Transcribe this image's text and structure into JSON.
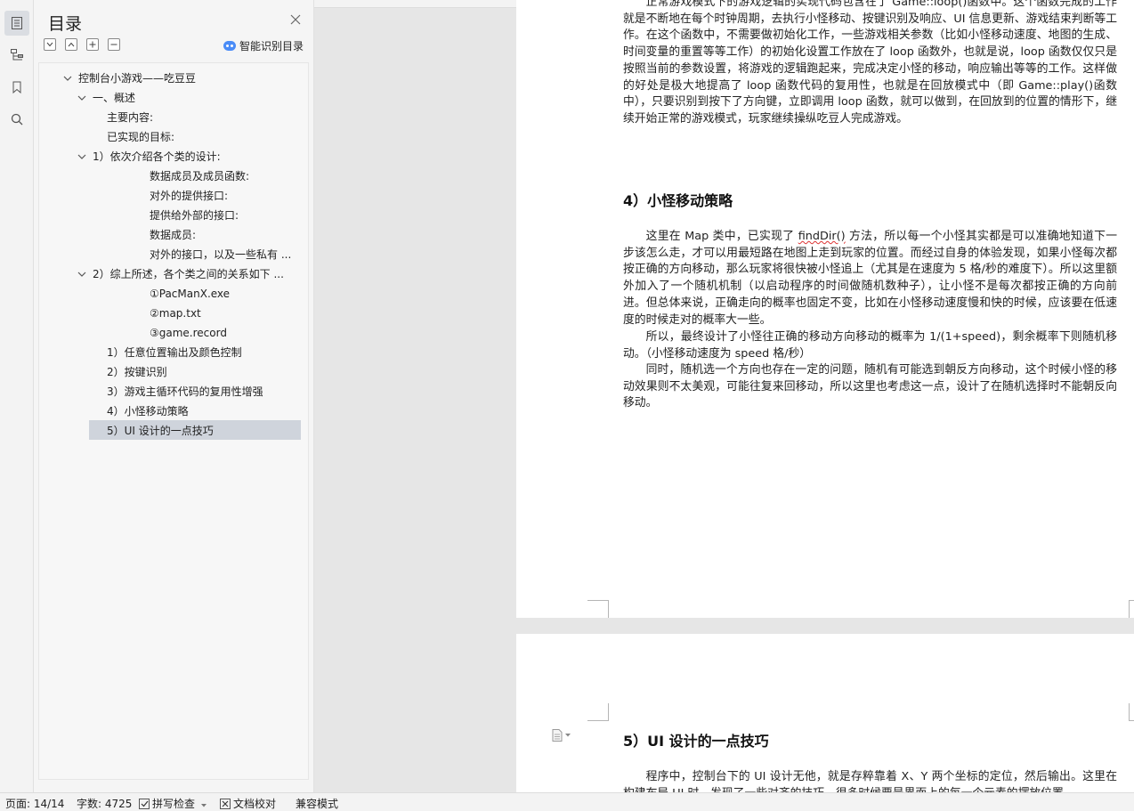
{
  "toc": {
    "title": "目录",
    "smart_label": "智能识别目录",
    "items": [
      {
        "label": "控制台小游戏——吃豆豆",
        "level": 0,
        "expanded": true
      },
      {
        "label": "一、概述",
        "level": 1,
        "expanded": true
      },
      {
        "label": "主要内容:",
        "level": 2
      },
      {
        "label": "已实现的目标:",
        "level": 2
      },
      {
        "label": "1）依次介绍各个类的设计:",
        "level": 1,
        "expanded": true
      },
      {
        "label": "数据成员及成员函数:",
        "level": 3
      },
      {
        "label": "对外的提供接口:",
        "level": 3
      },
      {
        "label": "提供给外部的接口:",
        "level": 3
      },
      {
        "label": "数据成员:",
        "level": 3
      },
      {
        "label": "对外的接口，以及一些私有 ...",
        "level": 3
      },
      {
        "label": "2）综上所述，各个类之间的关系如下 ...",
        "level": 1,
        "expanded": true
      },
      {
        "label": "①PacManX.exe",
        "level": 3
      },
      {
        "label": "②map.txt",
        "level": 3
      },
      {
        "label": "③game.record",
        "level": 3
      },
      {
        "label": "1）任意位置输出及颜色控制",
        "level": 2
      },
      {
        "label": "2）按键识别",
        "level": 2
      },
      {
        "label": "3）游戏主循环代码的复用性增强",
        "level": 2
      },
      {
        "label": "4）小怪移动策略",
        "level": 2
      },
      {
        "label": "5）UI 设计的一点技巧",
        "level": 2,
        "selected": true
      }
    ]
  },
  "document": {
    "para1": "正常游戏模式下的游戏逻辑的实现代码包含在了 Game::loop()函数中。这个函数完成的工作就是不断地在每个时钟周期，去执行小怪移动、按键识别及响应、UI 信息更新、游戏结束判断等工作。在这个函数中，不需要做初始化工作，一些游戏相关参数（比如小怪移动速度、地图的生成、时间变量的重置等等工作）的初始化设置工作放在了 loop 函数外，也就是说，loop 函数仅仅只是按照当前的参数设置，将游戏的逻辑跑起来，完成决定小怪的移动，响应输出等等的工作。这样做的好处是极大地提高了 loop 函数代码的复用性，也就是在回放模式中（即 Game::play()函数中），只要识别到按下了方向键，立即调用 loop 函数，就可以做到，在回放到的位置的情形下，继续开始正常的游戏模式，玩家继续操纵吃豆人完成游戏。",
    "heading4": "4）小怪移动策略",
    "para2_a": "这里在 Map 类中，已实现了 ",
    "para2_term": "findDir()",
    "para2_b": " 方法，所以每一个小怪其实都是可以准确地知道下一步该怎么走，才可以用最短路在地图上走到玩家的位置。而经过自身的体验发现，如果小怪每次都按正确的方向移动，那么玩家将很快被小怪追上（尤其是在速度为 5 格/秒的难度下）。所以这里额外加入了一个随机机制（以启动程序的时间做随机数种子），让小怪不是每次都按正确的方向前进。但总体来说，正确走向的概率也固定不变，比如在小怪移动速度慢和快的时候，应该要在低速度的时候走对的概率大一些。",
    "para3": "所以，最终设计了小怪往正确的移动方向移动的概率为 1/(1+speed)，剩余概率下则随机移动。（小怪移动速度为 speed 格/秒）",
    "para4": "同时，随机选一个方向也存在一定的问题，随机有可能选到朝反方向移动，这个时候小怪的移动效果则不太美观，可能往复来回移动，所以这里也考虑这一点，设计了在随机选择时不能朝反向移动。",
    "heading5": "5）UI 设计的一点技巧",
    "para5": "程序中，控制台下的 UI 设计无他，就是存粹靠着 X、Y 两个坐标的定位，然后输出。这里在构建布局 UI 时，发现了一些对齐的技巧，很多时候要是界面上的每一个元素的摆放位置"
  },
  "status": {
    "page": "页面: 14/14",
    "words": "字数: 4725",
    "spell": "拼写检查",
    "proof": "文档校对",
    "compat": "兼容模式"
  },
  "colors": {
    "selection": "#cfd4dc",
    "accent": "#4a8cf7"
  }
}
